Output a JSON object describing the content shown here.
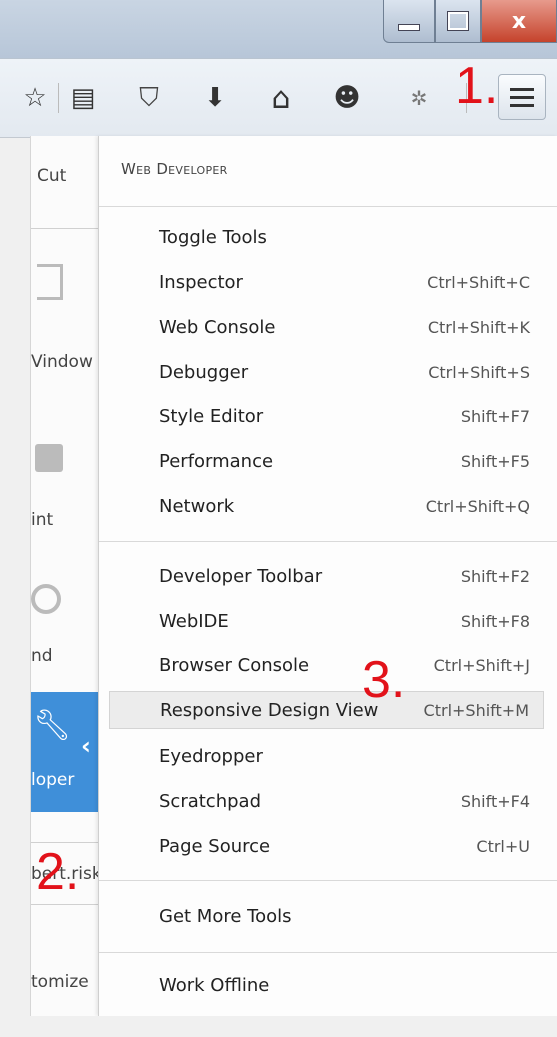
{
  "window": {
    "min_icon": "minimize-icon",
    "max_icon": "maximize-icon",
    "close_label": "x"
  },
  "toolbar": {
    "icons": [
      "star-icon",
      "reading-list-icon",
      "pocket-icon",
      "download-icon",
      "home-icon",
      "hello-icon",
      "extension-icon"
    ],
    "star_glyph": "☆",
    "reading_glyph": "▤",
    "pocket_glyph": "⛉",
    "download_glyph": "⬇",
    "home_glyph": "⌂",
    "hello_glyph": "☻",
    "ext_glyph": "✲"
  },
  "annotations": {
    "one": "1.",
    "two": "2.",
    "three": "3."
  },
  "left_panel": {
    "cut": "Cut",
    "window": "Vindow",
    "print": "int",
    "find": "nd",
    "developer": "loper",
    "account": "bert.risk",
    "customize": "tomize"
  },
  "menu": {
    "header_first": "Web",
    "header_second": "Developer",
    "group1": [
      {
        "label": "Toggle Tools",
        "shortcut": ""
      },
      {
        "label": "Inspector",
        "shortcut": "Ctrl+Shift+C"
      },
      {
        "label": "Web Console",
        "shortcut": "Ctrl+Shift+K"
      },
      {
        "label": "Debugger",
        "shortcut": "Ctrl+Shift+S"
      },
      {
        "label": "Style Editor",
        "shortcut": "Shift+F7"
      },
      {
        "label": "Performance",
        "shortcut": "Shift+F5"
      },
      {
        "label": "Network",
        "shortcut": "Ctrl+Shift+Q"
      }
    ],
    "group2": [
      {
        "label": "Developer Toolbar",
        "shortcut": "Shift+F2"
      },
      {
        "label": "WebIDE",
        "shortcut": "Shift+F8"
      },
      {
        "label": "Browser Console",
        "shortcut": "Ctrl+Shift+J"
      },
      {
        "label": "Responsive Design View",
        "shortcut": "Ctrl+Shift+M"
      },
      {
        "label": "Eyedropper",
        "shortcut": ""
      },
      {
        "label": "Scratchpad",
        "shortcut": "Shift+F4"
      },
      {
        "label": "Page Source",
        "shortcut": "Ctrl+U"
      }
    ],
    "more_tools": "Get More Tools",
    "work_offline": "Work Offline"
  },
  "colors": {
    "accent": "#3f8fd9",
    "annotation": "#e2121a"
  }
}
